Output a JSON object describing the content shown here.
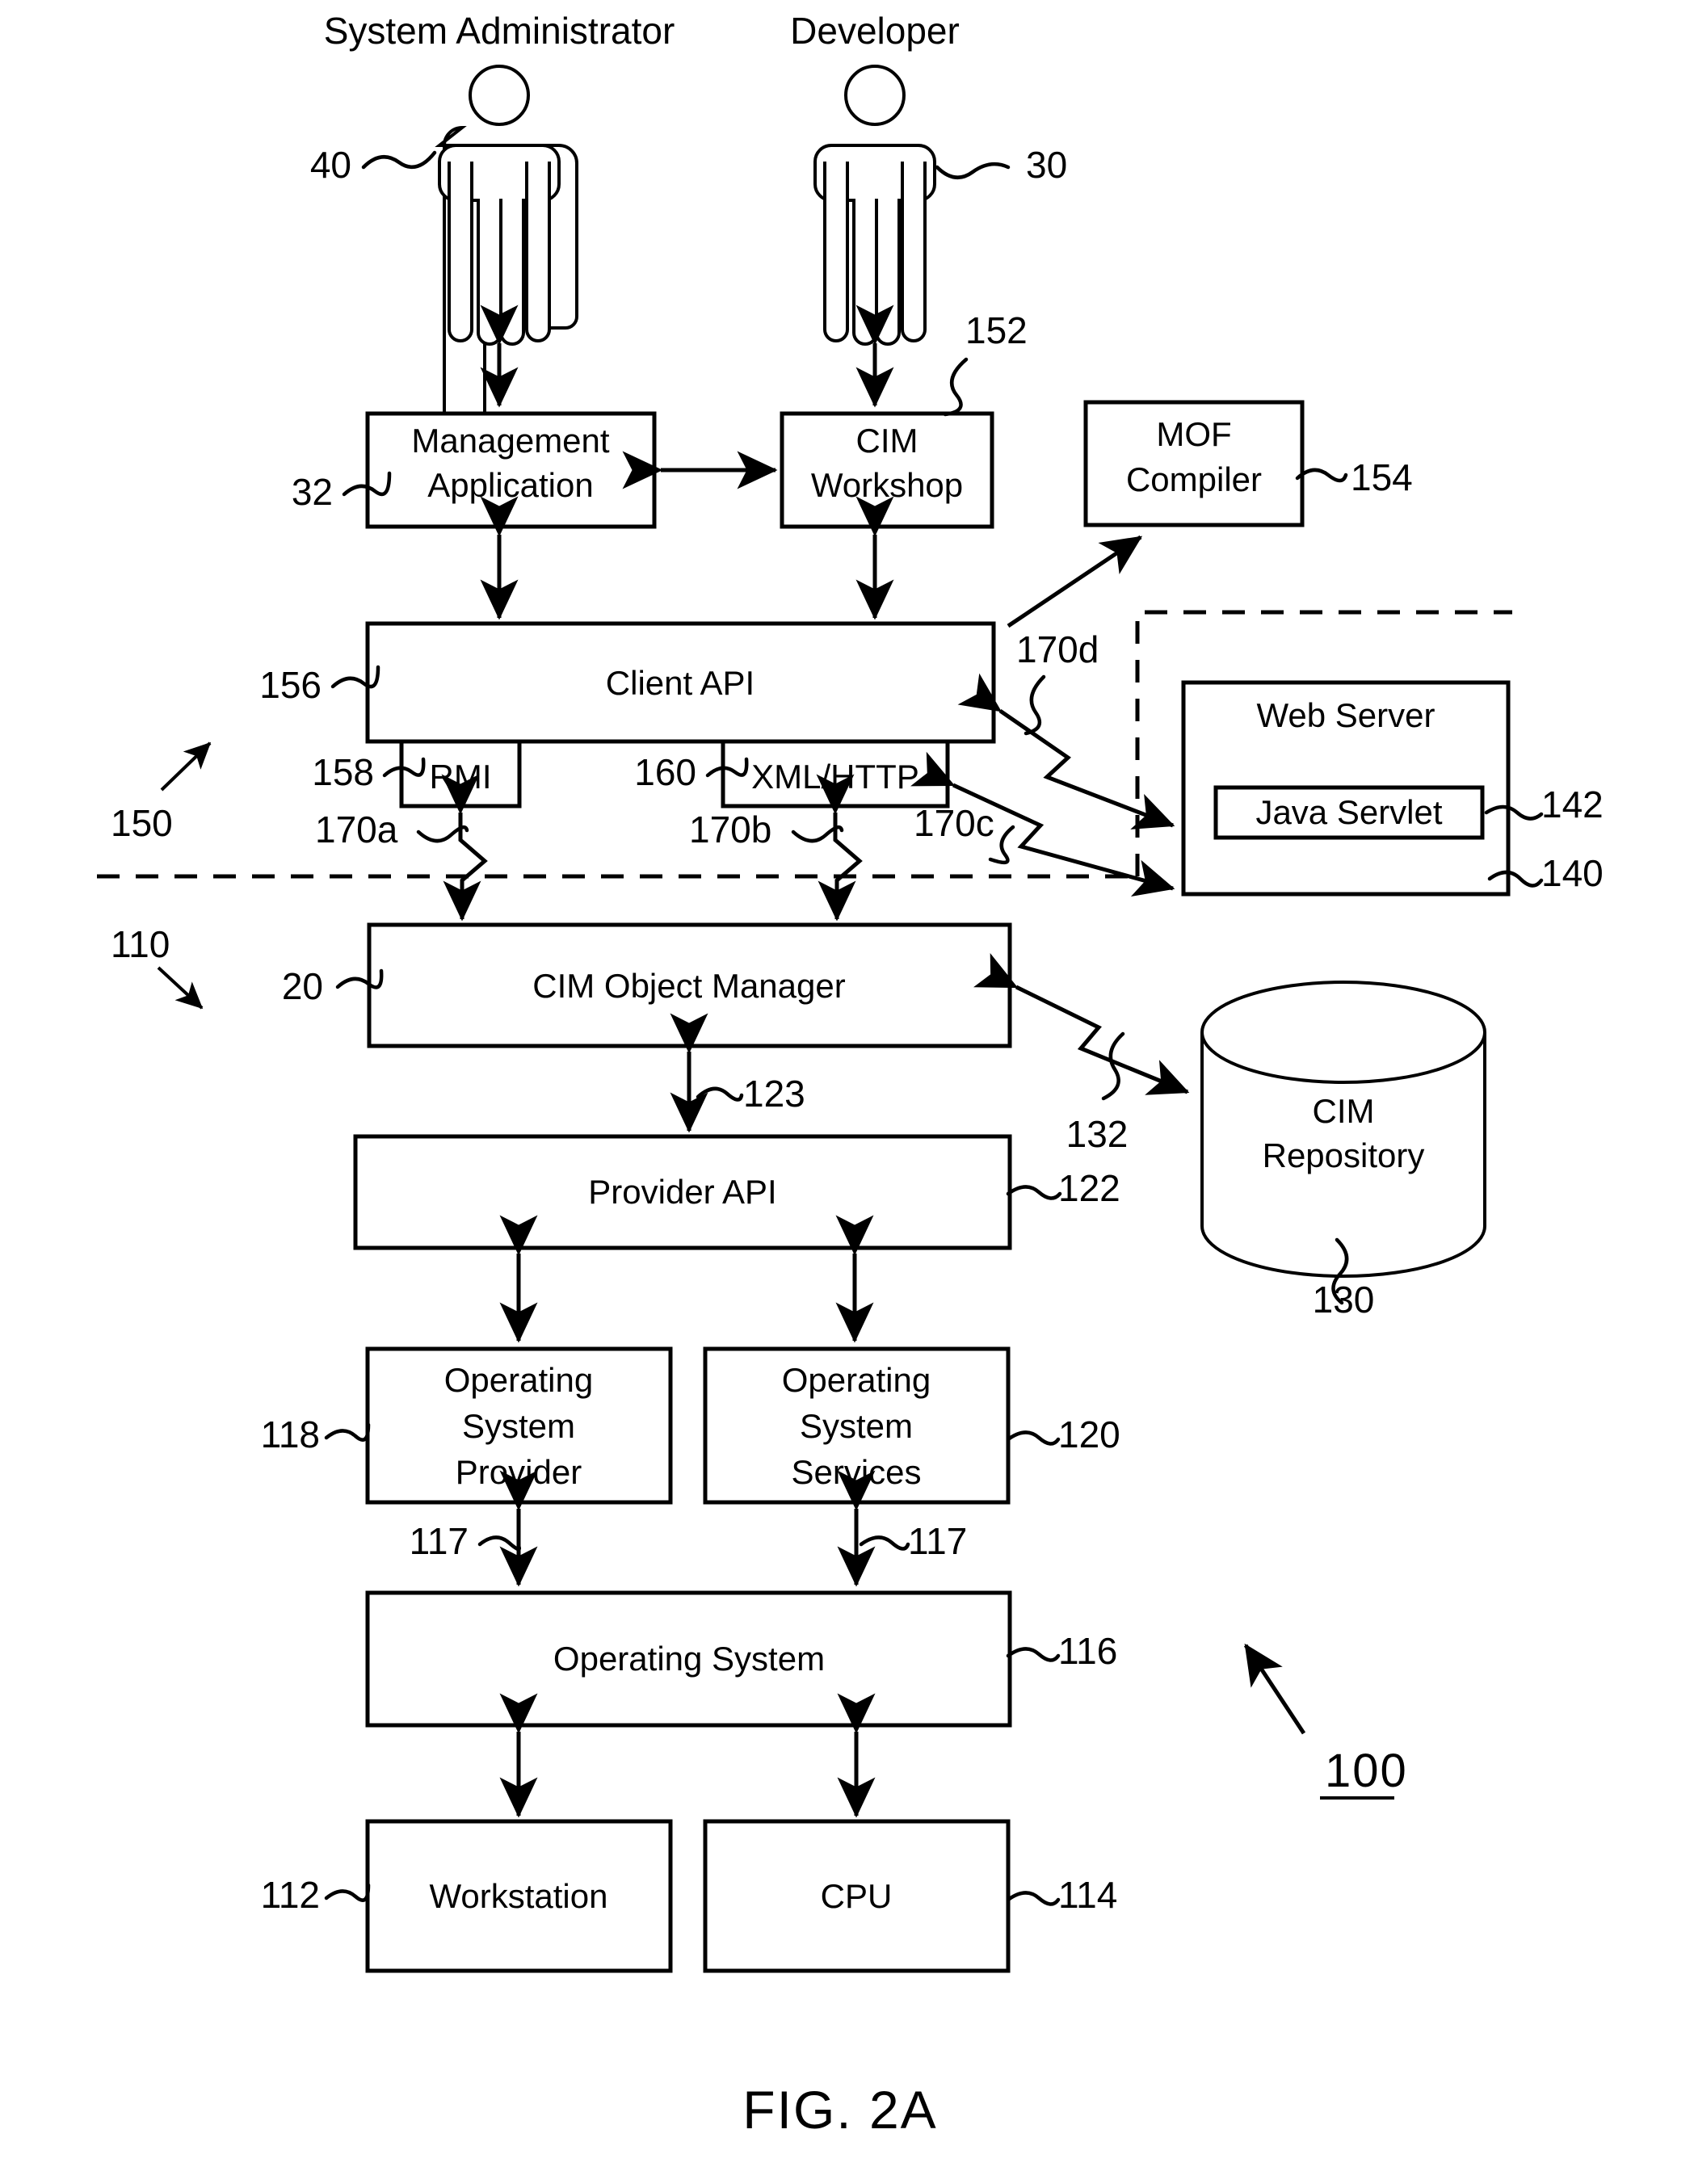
{
  "figure": {
    "caption": "FIG. 2A",
    "system_ref": "100"
  },
  "actors": [
    {
      "id": "sysadmin",
      "label": "System Administrator",
      "ref": "40"
    },
    {
      "id": "developer",
      "label": "Developer",
      "ref": "30"
    }
  ],
  "boxes": [
    {
      "id": "management-application",
      "label_line1": "Management",
      "label_line2": "Application",
      "ref": "32"
    },
    {
      "id": "cim-workshop",
      "label_line1": "CIM",
      "label_line2": "Workshop",
      "ref": "152"
    },
    {
      "id": "mof-compiler",
      "label_line1": "MOF",
      "label_line2": "Compiler",
      "ref": "154"
    },
    {
      "id": "client-api",
      "label_line1": "Client API",
      "label_line2": "",
      "ref": "156"
    },
    {
      "id": "rmi",
      "label_line1": "RMI",
      "label_line2": "",
      "ref": "158"
    },
    {
      "id": "xml-http",
      "label_line1": "XML/HTTP",
      "label_line2": "",
      "ref": "160"
    },
    {
      "id": "web-server",
      "label_line1": "Web Server",
      "label_line2": "",
      "ref": "140"
    },
    {
      "id": "java-servlet",
      "label_line1": "Java Servlet",
      "label_line2": "",
      "ref": "142"
    },
    {
      "id": "cim-object-manager",
      "label_line1": "CIM Object Manager",
      "label_line2": "",
      "ref": "20"
    },
    {
      "id": "cim-repository",
      "label_line1": "CIM",
      "label_line2": "Repository",
      "ref": "130"
    },
    {
      "id": "provider-api",
      "label_line1": "Provider API",
      "label_line2": "",
      "ref": "122"
    },
    {
      "id": "operating-system-provider",
      "label_line1": "Operating",
      "label_line2": "System",
      "label_line3": "Provider",
      "ref": "118"
    },
    {
      "id": "operating-system-services",
      "label_line1": "Operating",
      "label_line2": "System",
      "label_line3": "Services",
      "ref": "120"
    },
    {
      "id": "operating-system",
      "label_line1": "Operating System",
      "label_line2": "",
      "ref": "116"
    },
    {
      "id": "workstation",
      "label_line1": "Workstation",
      "label_line2": "",
      "ref": "112"
    },
    {
      "id": "cpu",
      "label_line1": "CPU",
      "label_line2": "",
      "ref": "114"
    }
  ],
  "connector_refs": {
    "c123": "123",
    "c132": "132",
    "c117a": "117",
    "c117b": "117",
    "c170a": "170a",
    "c170b": "170b",
    "c170c": "170c",
    "c170d": "170d"
  },
  "region_refs": {
    "client_side": "150",
    "server_side": "110"
  },
  "colors": {
    "stroke": "#000000",
    "background": "#ffffff"
  }
}
